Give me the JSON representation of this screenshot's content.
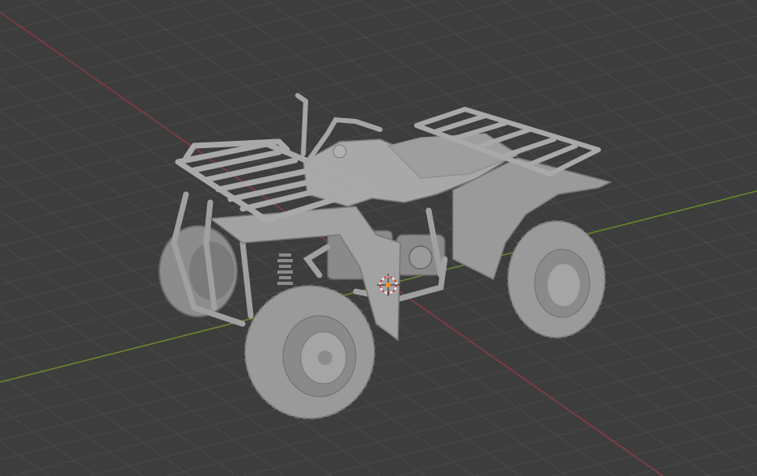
{
  "viewport": {
    "background": "#3d3d3d",
    "grid_color": "#4a4a4a",
    "x_axis_color": "#8a3a43",
    "y_axis_color": "#6a8a2a",
    "model_color": "#9c9c9c",
    "model_shadow": "#6e6e6e",
    "model_highlight": "#bdbdbd"
  },
  "scene": {
    "object": "atv-model",
    "cursor_icon": "3d-cursor-icon"
  }
}
